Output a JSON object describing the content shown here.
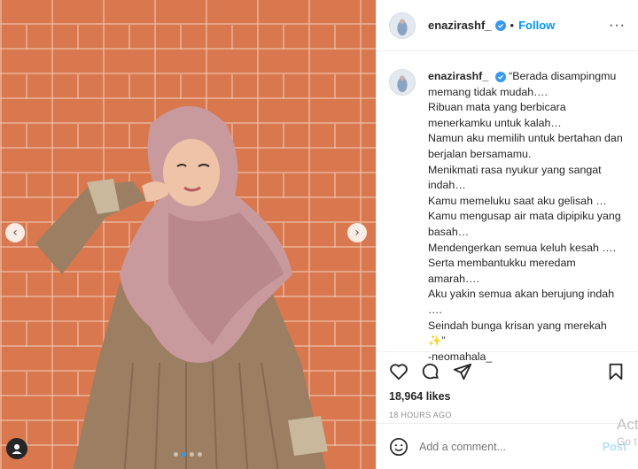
{
  "post": {
    "username": "enazirashf_",
    "follow_label": "Follow",
    "more_label": "···",
    "caption_lines": "“Berada disampingmu memang tidak mudah….\nRibuan mata yang berbicara menerkamku untuk kalah…\nNamun aku memilih untuk bertahan dan berjalan bersamamu.\nMenikmati rasa nyukur yang sangat indah…\nKamu memeluku saat aku gelisah …\nKamu mengusap air mata dipipiku yang basah…\nMendengerkan semua keluh kesah ….\nSerta membantukku meredam amarah….\nAku yakin semua akan berujung indah ….\nSeindah bunga krisan yang merekah\n✨”\n-neomahala_",
    "likes": "18,964 likes",
    "time": "18 HOURS AGO"
  },
  "comment": {
    "placeholder": "Add a comment...",
    "post_label": "Post"
  },
  "carousel": {
    "prev_glyph": "‹",
    "next_glyph": "›",
    "slides": 4,
    "active_index": 1
  },
  "overlay": {
    "activate_title": "Act",
    "activate_sub": "Go t"
  },
  "colors": {
    "accent": "#0095f6",
    "verified": "#3897f0",
    "brick": "#d9784f"
  },
  "icons": [
    "heart-icon",
    "comment-icon",
    "share-icon",
    "bookmark-icon",
    "emoji-icon",
    "verified-icon",
    "more-icon",
    "tag-user-icon"
  ]
}
